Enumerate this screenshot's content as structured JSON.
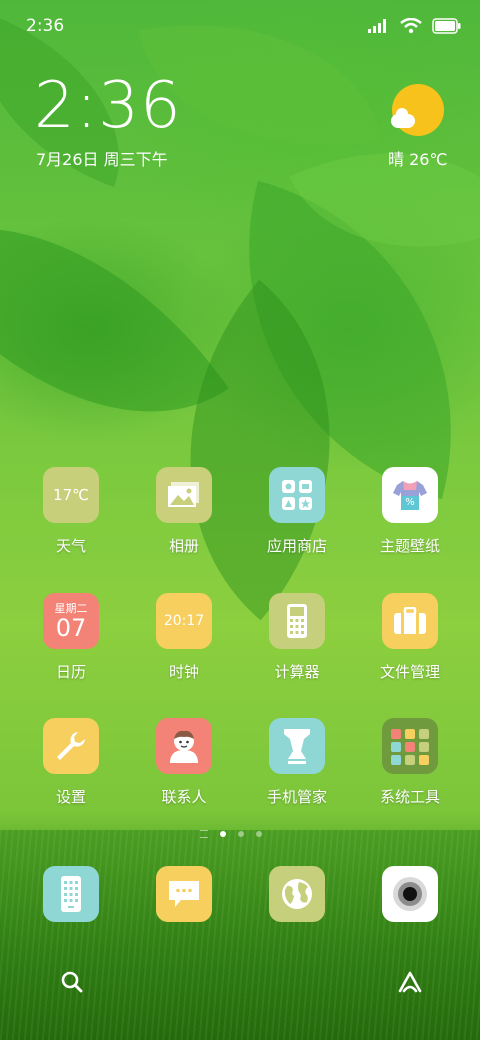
{
  "status_bar": {
    "time": "2:36",
    "signal_icon": "signal-icon",
    "wifi_icon": "wifi-icon",
    "battery_icon": "battery-icon"
  },
  "clock_widget": {
    "time": "2:36",
    "date": "7月26日 周三下午"
  },
  "weather_widget": {
    "icon": "sun-cloud-icon",
    "text": "晴 26℃"
  },
  "apps": [
    {
      "name": "weather",
      "label": "天气",
      "icon_text": "17℃",
      "color": "#c7cf7a"
    },
    {
      "name": "gallery",
      "label": "相册",
      "color": "#c9cf7b"
    },
    {
      "name": "app-store",
      "label": "应用商店",
      "color": "#8fd7d5"
    },
    {
      "name": "themes",
      "label": "主题壁纸",
      "color": "#ffffff"
    },
    {
      "name": "calendar",
      "label": "日历",
      "icon_top": "星期二",
      "icon_day": "07",
      "color": "#f38376"
    },
    {
      "name": "clock",
      "label": "时钟",
      "icon_text": "20:17",
      "color": "#f6cf5e"
    },
    {
      "name": "calculator",
      "label": "计算器",
      "color": "#c6cf7c"
    },
    {
      "name": "file-manager",
      "label": "文件管理",
      "color": "#f6cf5e"
    },
    {
      "name": "settings",
      "label": "设置",
      "color": "#f6cf5e"
    },
    {
      "name": "contacts",
      "label": "联系人",
      "color": "#f38376"
    },
    {
      "name": "security",
      "label": "手机管家",
      "color": "#8fd7d5"
    },
    {
      "name": "system-tools",
      "label": "系统工具",
      "color": "#6f9a3d"
    }
  ],
  "page_indicator": {
    "pages": 3,
    "current": 1
  },
  "dock": [
    {
      "name": "phone",
      "color": "#8fd7d5"
    },
    {
      "name": "messages",
      "color": "#f6cf5e"
    },
    {
      "name": "browser",
      "color": "#c6cf7c"
    },
    {
      "name": "camera",
      "color": "#ffffff"
    }
  ],
  "bottom_bar": {
    "left_icon": "search-icon",
    "right_icon": "assistant-icon"
  }
}
